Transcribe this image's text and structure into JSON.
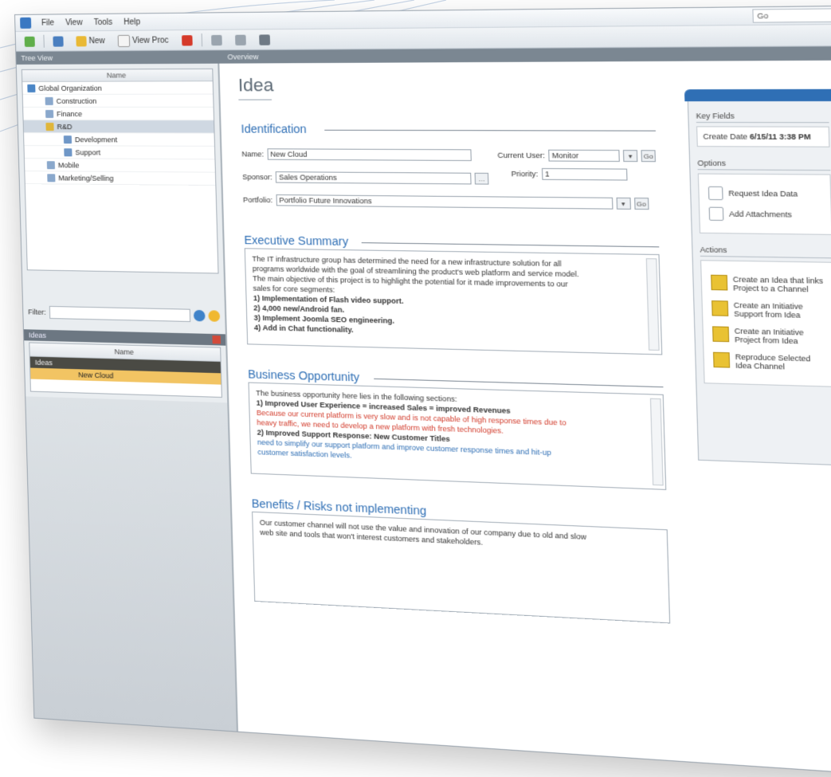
{
  "menu": {
    "items": [
      "File",
      "View",
      "Tools",
      "Help"
    ],
    "right_box": "Go"
  },
  "toolbar": {
    "new_label": "New",
    "view_label": "View Proc"
  },
  "tabs": {
    "left": "Tree View",
    "right": "Overview"
  },
  "sidebar": {
    "tree_header": "Name",
    "tree_items": [
      {
        "label": "Global Organization",
        "level": 0,
        "selected": false
      },
      {
        "label": "Construction",
        "level": 1,
        "selected": false
      },
      {
        "label": "Finance",
        "level": 1,
        "selected": false
      },
      {
        "label": "R&D",
        "level": 1,
        "selected": true
      },
      {
        "label": "Development",
        "level": 2,
        "selected": false
      },
      {
        "label": "Support",
        "level": 2,
        "selected": false
      },
      {
        "label": "Mobile",
        "level": 1,
        "selected": false
      },
      {
        "label": "Marketing/Selling",
        "level": 1,
        "selected": false
      }
    ],
    "filter_label": "Filter:",
    "list_title": "Ideas",
    "list_header": "Name",
    "list_rows": [
      "Ideas",
      "New Cloud"
    ]
  },
  "main": {
    "page_title": "Idea",
    "identification": {
      "title": "Identification",
      "name_label": "Name:",
      "name_value": "New Cloud",
      "current_user_label": "Current User:",
      "current_user_value": "Monitor",
      "sponsor_label": "Sponsor:",
      "sponsor_value": "Sales Operations",
      "priority_label": "Priority:",
      "priority_value": "1",
      "portfolio_label": "Portfolio:",
      "portfolio_value": "Portfolio Future Innovations",
      "go_label": "Go"
    },
    "executive": {
      "title": "Executive Summary",
      "text_lines": [
        {
          "text": "The IT infrastructure group has determined the need for a new infrastructure solution for all",
          "style": "normal"
        },
        {
          "text": "programs worldwide with the goal of streamlining the product's web platform and service model.",
          "style": "normal"
        },
        {
          "text": "The main objective of this project is to highlight the potential for it made improvements to our",
          "style": "normal"
        },
        {
          "text": "sales for core segments:",
          "style": "normal"
        },
        {
          "text": "1) Implementation of Flash video support.",
          "style": "bold"
        },
        {
          "text": "2) 4,000 new/Android fan.",
          "style": "bold"
        },
        {
          "text": "3) Implement Joomla SEO engineering.",
          "style": "bold"
        },
        {
          "text": "4) Add in Chat functionality.",
          "style": "bold"
        }
      ]
    },
    "business": {
      "title": "Business Opportunity",
      "text_lines": [
        {
          "text": "The business opportunity here lies in the following sections:",
          "style": "normal"
        },
        {
          "text": "1) Improved User Experience = increased Sales = improved Revenues",
          "style": "bold"
        },
        {
          "text": "   Because our current platform is very slow and is not capable of high response times due to",
          "style": "red"
        },
        {
          "text": "   heavy traffic, we need to develop a new platform with fresh technologies.",
          "style": "red"
        },
        {
          "text": "2) Improved Support Response: New Customer Titles",
          "style": "bold"
        },
        {
          "text": "   need to simplify our support platform and improve customer response times and hit-up",
          "style": "blue"
        },
        {
          "text": "   customer satisfaction levels.",
          "style": "blue"
        }
      ]
    },
    "benefits": {
      "title": "Benefits / Risks not implementing",
      "text_lines": [
        {
          "text": "Our customer channel will not use the value and innovation of our company due to old and slow",
          "style": "normal"
        },
        {
          "text": "web site and tools that won't interest customers and stakeholders.",
          "style": "normal"
        }
      ]
    }
  },
  "rightpanel": {
    "key_fields_label": "Key Fields",
    "create_date_label": "Create Date",
    "create_date_value": "6/15/11 3:38 PM",
    "options_label": "Options",
    "option_items": [
      "Request Idea Data",
      "Add Attachments"
    ],
    "actions_label": "Actions",
    "action_items": [
      "Create an Idea that links Project to a Channel",
      "Create an Initiative Support from Idea",
      "Create an Initiative Project from Idea",
      "Reproduce Selected Idea Channel"
    ]
  },
  "colors": {
    "accent": "#2f6fb5",
    "selection": "#f2c463",
    "risk_red": "#d23b2b"
  }
}
